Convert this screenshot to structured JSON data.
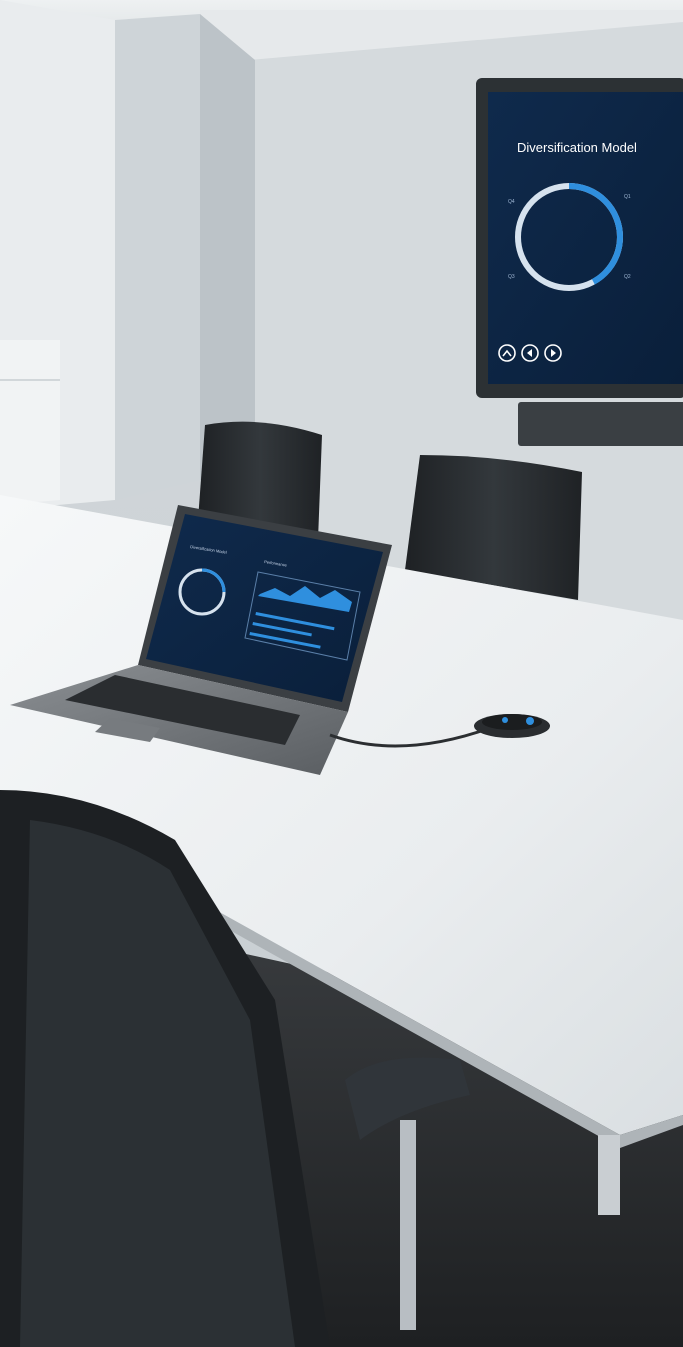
{
  "tv": {
    "title": "Diversification Model",
    "quadrants": {
      "q1": "Q1",
      "q2": "Q2",
      "q3": "Q3",
      "q4": "Q4"
    },
    "ring_progress": 0.42,
    "nav_icons": [
      "chevron-up-icon",
      "chevron-left-icon",
      "chevron-right-icon"
    ]
  },
  "laptop": {
    "screen_title_left": "Diversification Model",
    "screen_title_right": "Performance"
  },
  "colors": {
    "screen_bg": "#0d2544",
    "accent": "#2f8fde",
    "ring_track": "#d6e2ee",
    "table": "#f3f5f7",
    "wall": "#dde1e4",
    "chair": "#2a2e31"
  }
}
